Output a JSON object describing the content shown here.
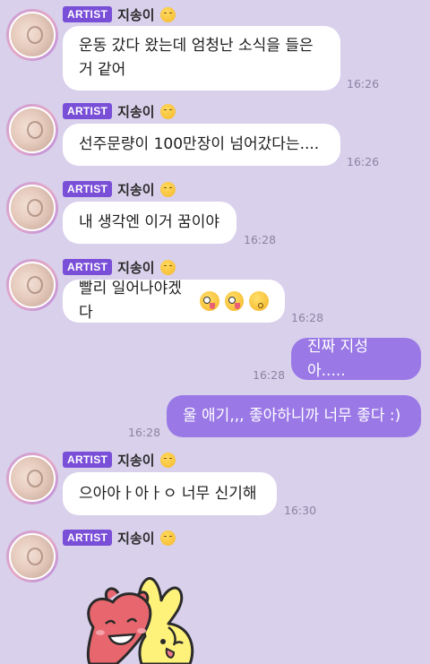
{
  "colors": {
    "background": "#d9d0ec",
    "artist_badge": "#7a4fd8",
    "my_bubble": "#9a78e6",
    "their_bubble": "#ffffff"
  },
  "artist": {
    "badge": "ARTIST",
    "name": "지송이"
  },
  "messages": [
    {
      "from": "artist",
      "lines": [
        "운동 갔다 왔는데 엄청난 소식을 들은",
        "거 같어"
      ],
      "time": "16:26"
    },
    {
      "from": "artist",
      "text": "선주문량이 100만장이 넘어갔다는....",
      "time": "16:26"
    },
    {
      "from": "artist",
      "text": "내 생각엔 이거 꿈이야",
      "time": "16:28"
    },
    {
      "from": "artist",
      "text": "빨리 일어나야겠다",
      "emojis": [
        "zany-face-icon",
        "zany-face-icon",
        "kissing-face-icon"
      ],
      "time": "16:28"
    },
    {
      "from": "me",
      "text": "진짜 지성아.....",
      "time": "16:28"
    },
    {
      "from": "me",
      "text": "울 애기,,, 좋아하니까 너무 좋다 :)",
      "time": "16:28"
    },
    {
      "from": "artist",
      "text": "으아아ㅏ아ㅏㅇ 너무 신기해",
      "time": "16:30"
    },
    {
      "from": "artist",
      "sticker": "heart-and-bunny-sticker"
    }
  ]
}
